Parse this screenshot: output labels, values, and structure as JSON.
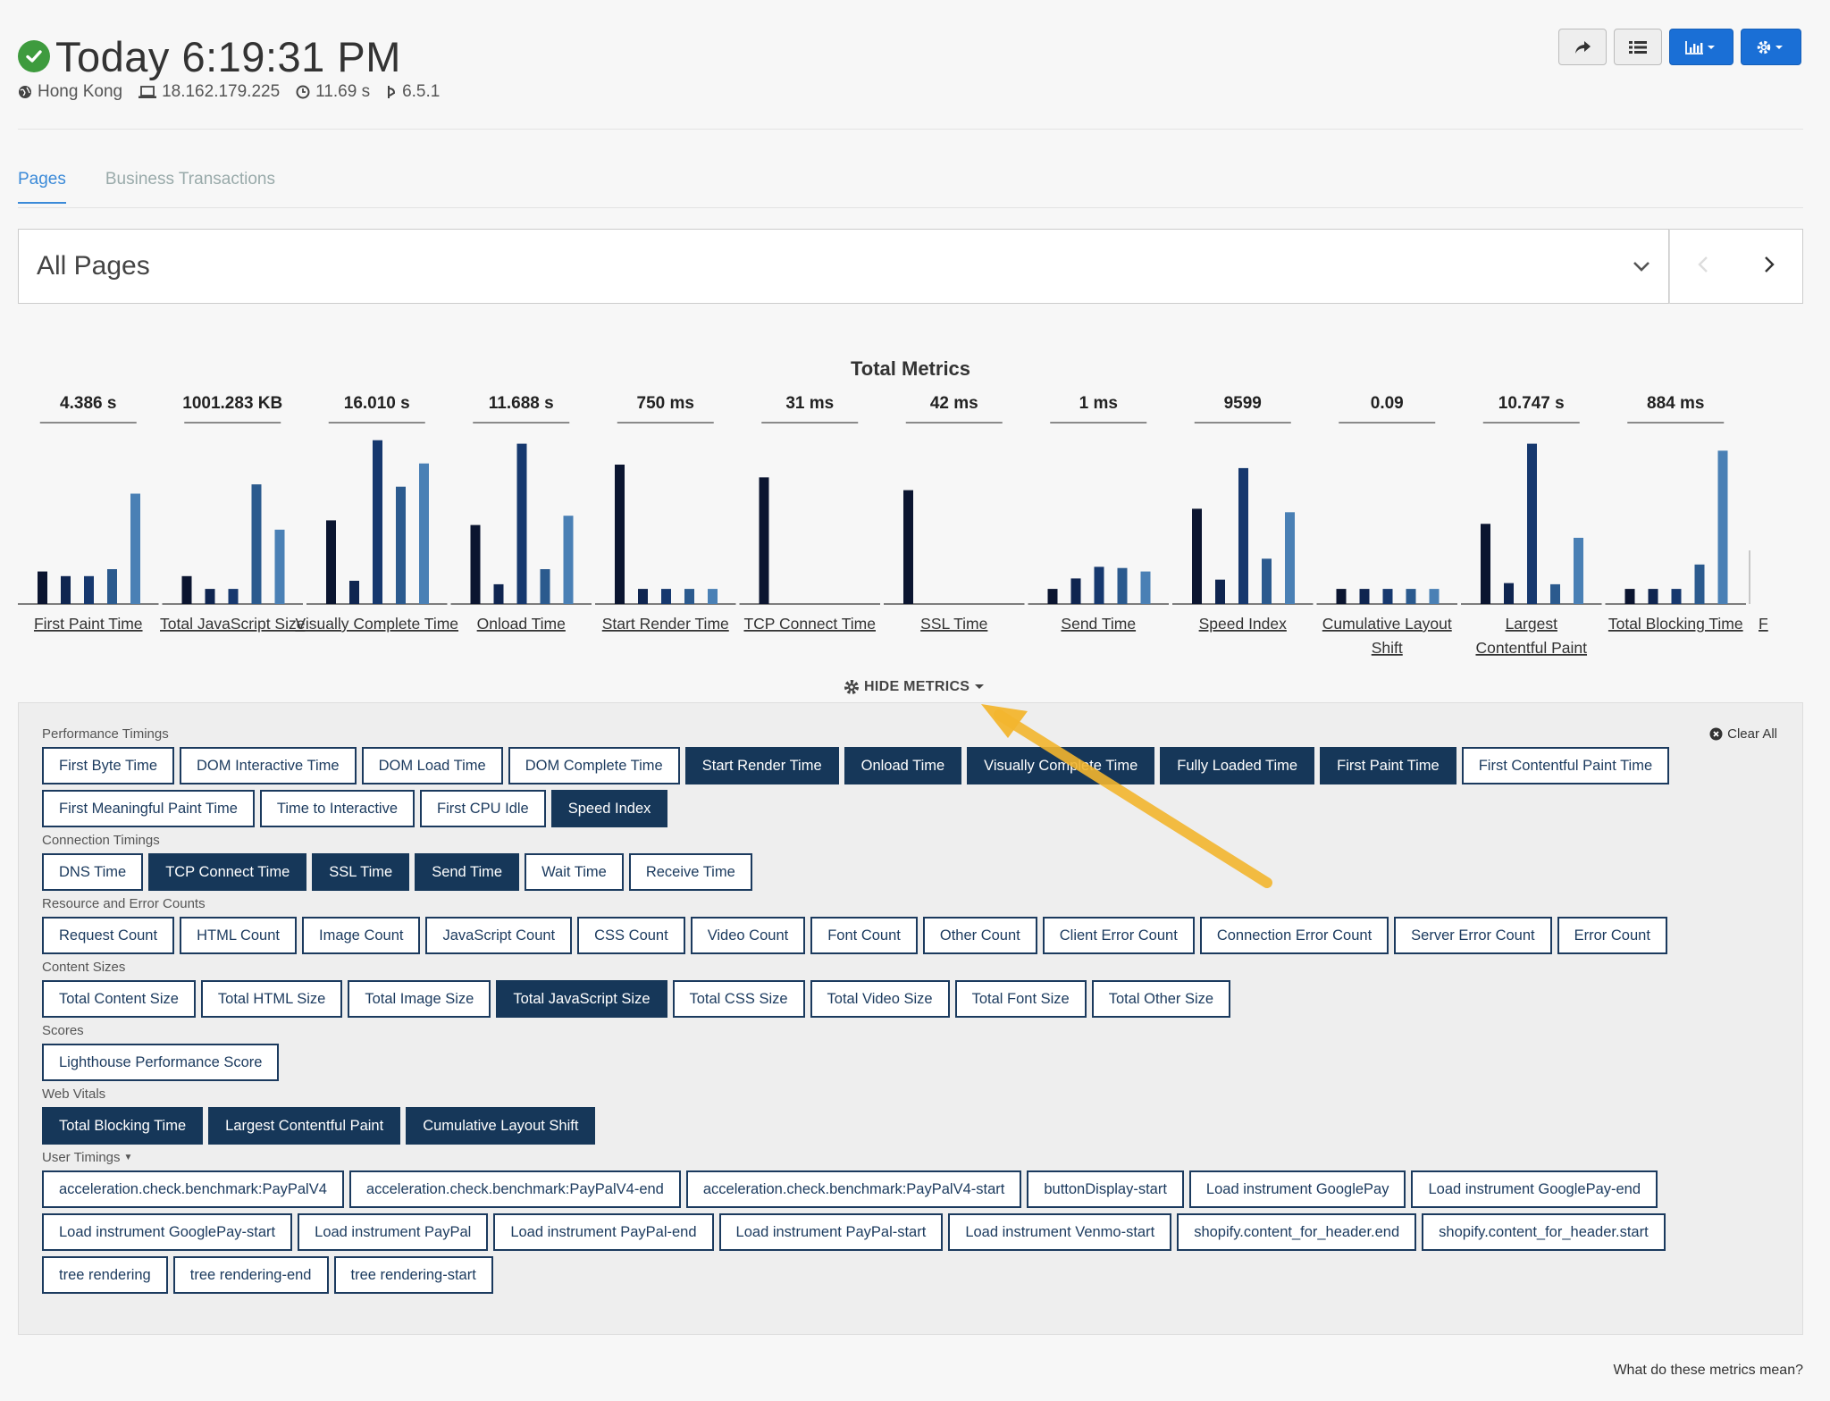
{
  "header": {
    "title": "Today 6:19:31 PM",
    "location": "Hong Kong",
    "ip": "18.162.179.225",
    "duration": "11.69 s",
    "version": "6.5.1"
  },
  "tabs": [
    {
      "label": "Pages",
      "active": true
    },
    {
      "label": "Business Transactions",
      "active": false
    }
  ],
  "page_select": {
    "value": "All Pages"
  },
  "chart_data": {
    "type": "bar",
    "title": "Total Metrics",
    "groups": [
      {
        "label": "First Paint Time",
        "value_label": "4.386 s",
        "values": [
          28,
          24,
          24,
          30,
          95
        ]
      },
      {
        "label": "Total JavaScript Size",
        "value_label": "1001.283 KB",
        "values": [
          24,
          13,
          13,
          103,
          64
        ]
      },
      {
        "label": "Visually Complete Time",
        "value_label": "16.010 s",
        "values": [
          72,
          20,
          141,
          101,
          121
        ]
      },
      {
        "label": "Onload Time",
        "value_label": "11.688 s",
        "values": [
          68,
          17,
          138,
          30,
          76
        ]
      },
      {
        "label": "Start Render Time",
        "value_label": "750 ms",
        "values": [
          120,
          13,
          13,
          13,
          13
        ]
      },
      {
        "label": "TCP Connect Time",
        "value_label": "31 ms",
        "values": [
          109
        ]
      },
      {
        "label": "SSL Time",
        "value_label": "42 ms",
        "values": [
          98
        ]
      },
      {
        "label": "Send Time",
        "value_label": "1 ms",
        "values": [
          13,
          22,
          32,
          31,
          28
        ]
      },
      {
        "label": "Speed Index",
        "value_label": "9599",
        "values": [
          82,
          21,
          117,
          39,
          79
        ]
      },
      {
        "label": "Cumulative Layout Shift",
        "value_label": "0.09",
        "values": [
          13,
          13,
          13,
          13,
          13
        ]
      },
      {
        "label": "Largest Contentful Paint",
        "value_label": "10.747 s",
        "values": [
          69,
          18,
          138,
          17,
          57
        ]
      },
      {
        "label": "Total Blocking Time",
        "value_label": "884 ms",
        "values": [
          13,
          13,
          13,
          34,
          132
        ]
      },
      {
        "label": "F",
        "value_label": "",
        "values": []
      }
    ],
    "colors": [
      "#0b1530",
      "#0f2550",
      "#16386e",
      "#2b5a8e",
      "#4a80b5"
    ]
  },
  "hide_metrics_label": "HIDE METRICS",
  "clear_all_label": "Clear All",
  "metric_sections": [
    {
      "title": "Performance Timings",
      "rows": [
        [
          {
            "label": "First Byte Time",
            "on": false
          },
          {
            "label": "DOM Interactive Time",
            "on": false
          },
          {
            "label": "DOM Load Time",
            "on": false
          },
          {
            "label": "DOM Complete Time",
            "on": false
          },
          {
            "label": "Start Render Time",
            "on": true
          },
          {
            "label": "Onload Time",
            "on": true
          },
          {
            "label": "Visually Complete Time",
            "on": true
          },
          {
            "label": "Fully Loaded Time",
            "on": true
          },
          {
            "label": "First Paint Time",
            "on": true
          },
          {
            "label": "First Contentful Paint Time",
            "on": false
          }
        ],
        [
          {
            "label": "First Meaningful Paint Time",
            "on": false
          },
          {
            "label": "Time to Interactive",
            "on": false
          },
          {
            "label": "First CPU Idle",
            "on": false
          },
          {
            "label": "Speed Index",
            "on": true
          }
        ]
      ]
    },
    {
      "title": "Connection Timings",
      "rows": [
        [
          {
            "label": "DNS Time",
            "on": false
          },
          {
            "label": "TCP Connect Time",
            "on": true
          },
          {
            "label": "SSL Time",
            "on": true
          },
          {
            "label": "Send Time",
            "on": true
          },
          {
            "label": "Wait Time",
            "on": false
          },
          {
            "label": "Receive Time",
            "on": false
          }
        ]
      ]
    },
    {
      "title": "Resource and Error Counts",
      "rows": [
        [
          {
            "label": "Request Count",
            "on": false
          },
          {
            "label": "HTML Count",
            "on": false
          },
          {
            "label": "Image Count",
            "on": false
          },
          {
            "label": "JavaScript Count",
            "on": false
          },
          {
            "label": "CSS Count",
            "on": false
          },
          {
            "label": "Video Count",
            "on": false
          },
          {
            "label": "Font Count",
            "on": false
          },
          {
            "label": "Other Count",
            "on": false
          },
          {
            "label": "Client Error Count",
            "on": false
          },
          {
            "label": "Connection Error Count",
            "on": false
          },
          {
            "label": "Server Error Count",
            "on": false
          },
          {
            "label": "Error Count",
            "on": false
          }
        ]
      ]
    },
    {
      "title": "Content Sizes",
      "rows": [
        [
          {
            "label": "Total Content Size",
            "on": false
          },
          {
            "label": "Total HTML Size",
            "on": false
          },
          {
            "label": "Total Image Size",
            "on": false
          },
          {
            "label": "Total JavaScript Size",
            "on": true
          },
          {
            "label": "Total CSS Size",
            "on": false
          },
          {
            "label": "Total Video Size",
            "on": false
          },
          {
            "label": "Total Font Size",
            "on": false
          },
          {
            "label": "Total Other Size",
            "on": false
          }
        ]
      ]
    },
    {
      "title": "Scores",
      "rows": [
        [
          {
            "label": "Lighthouse Performance Score",
            "on": false
          }
        ]
      ]
    },
    {
      "title": "Web Vitals",
      "rows": [
        [
          {
            "label": "Total Blocking Time",
            "on": true
          },
          {
            "label": "Largest Contentful Paint",
            "on": true
          },
          {
            "label": "Cumulative Layout Shift",
            "on": true
          }
        ]
      ]
    },
    {
      "title": "User Timings",
      "caret": true,
      "rows": [
        [
          {
            "label": "acceleration.check.benchmark:PayPalV4",
            "on": false
          },
          {
            "label": "acceleration.check.benchmark:PayPalV4-end",
            "on": false
          },
          {
            "label": "acceleration.check.benchmark:PayPalV4-start",
            "on": false
          },
          {
            "label": "buttonDisplay-start",
            "on": false
          },
          {
            "label": "Load instrument GooglePay",
            "on": false
          },
          {
            "label": "Load instrument GooglePay-end",
            "on": false
          }
        ],
        [
          {
            "label": "Load instrument GooglePay-start",
            "on": false
          },
          {
            "label": "Load instrument PayPal",
            "on": false
          },
          {
            "label": "Load instrument PayPal-end",
            "on": false
          },
          {
            "label": "Load instrument PayPal-start",
            "on": false
          },
          {
            "label": "Load instrument Venmo-start",
            "on": false
          },
          {
            "label": "shopify.content_for_header.end",
            "on": false
          },
          {
            "label": "shopify.content_for_header.start",
            "on": false
          }
        ],
        [
          {
            "label": "tree rendering",
            "on": false
          },
          {
            "label": "tree rendering-end",
            "on": false
          },
          {
            "label": "tree rendering-start",
            "on": false
          }
        ]
      ]
    }
  ],
  "footer_link": "What do these metrics mean?"
}
